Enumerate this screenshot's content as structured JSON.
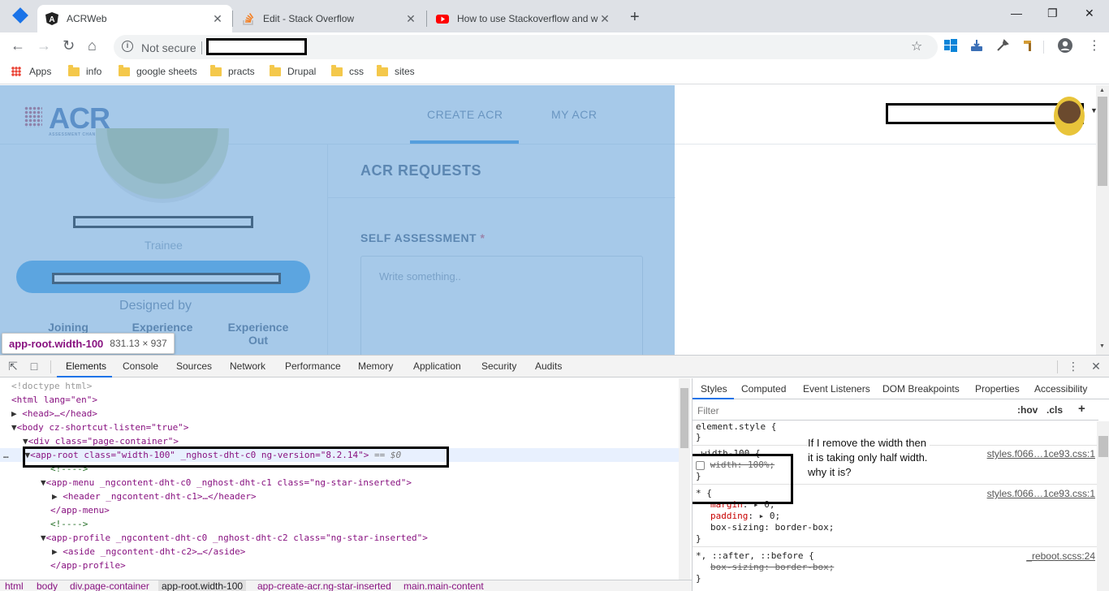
{
  "tabs": [
    {
      "title": "ACRWeb",
      "close": "✕"
    },
    {
      "title": "Edit - Stack Overflow",
      "close": "✕"
    },
    {
      "title": "How to use Stackoverflow and w",
      "close": "✕"
    }
  ],
  "new_tab": "+",
  "window_controls": {
    "minimize": "—",
    "maximize": "❐",
    "close": "✕"
  },
  "omnibox": {
    "security_label": "Not secure"
  },
  "bookmarks": [
    {
      "label": "Apps",
      "icon": "apps-grid-icon"
    },
    {
      "label": "info",
      "icon": "folder-icon"
    },
    {
      "label": "google sheets",
      "icon": "folder-icon"
    },
    {
      "label": "practs",
      "icon": "folder-icon"
    },
    {
      "label": "Drupal",
      "icon": "folder-icon"
    },
    {
      "label": "css",
      "icon": "folder-icon"
    },
    {
      "label": "sites",
      "icon": "folder-icon"
    }
  ],
  "app": {
    "logo": "ACR",
    "logo_tagline": "ASSESSMENT CHANGE REQUEST",
    "nav": {
      "create": "CREATE ACR",
      "mine": "MY ACR"
    },
    "profile": {
      "role": "Trainee",
      "designed_by": "Designed by",
      "stats": [
        "Joining",
        "Experience",
        "Experience Out"
      ]
    },
    "main": {
      "heading": "ACR REQUESTS",
      "field_label": "SELF ASSESSMENT",
      "required_mark": "*",
      "textarea_placeholder": "Write something.."
    },
    "overlay_color": "#6fa8dc"
  },
  "inspect_tooltip": {
    "name": "app-root.width-100",
    "size": "831.13 × 937"
  },
  "devtools": {
    "tabs": [
      "Elements",
      "Console",
      "Sources",
      "Network",
      "Performance",
      "Memory",
      "Application",
      "Security",
      "Audits"
    ],
    "dom_lines": {
      "doctype": "<!doctype html>",
      "html_open": "<html lang=\"en\">",
      "head": "<head>…</head>",
      "body": "<body cz-shortcut-listen=\"true\">",
      "div": "<div class=\"page-container\">",
      "app_root": "<app-root class=\"width-100\" _nghost-dht-c0 ng-version=\"8.2.14\">",
      "app_root_marker": "== $0",
      "comment1": "<!---->",
      "app_menu": "<app-menu _ngcontent-dht-c0 _nghost-dht-c1 class=\"ng-star-inserted\">",
      "header": "<header _ngcontent-dht-c1>…</header>",
      "app_menu_close": "</app-menu>",
      "comment2": "<!---->",
      "app_profile": "<app-profile _ngcontent-dht-c0 _nghost-dht-c2 class=\"ng-star-inserted\">",
      "aside": "<aside _ngcontent-dht-c2>…</aside>",
      "app_profile_close": "</app-profile>"
    },
    "breadcrumbs": [
      "html",
      "body",
      "div.page-container",
      "app-root.width-100",
      "app-create-acr.ng-star-inserted",
      "main.main-content"
    ],
    "styles_tabs": [
      "Styles",
      "Computed",
      "Event Listeners",
      "DOM Breakpoints",
      "Properties",
      "Accessibility"
    ],
    "filter_placeholder": "Filter",
    "filter_buttons": {
      "hov": ":hov",
      "cls": ".cls",
      "add": "+"
    },
    "rules": {
      "element_style": "element.style {",
      "close_brace": "}",
      "width_selector": ".width-100 {",
      "width_decl": "width: 100%;",
      "width_source": "styles.f066…1ce93.css:1",
      "star_selector": "* {",
      "margin_name": "margin",
      "margin_val": "0;",
      "padding_name": "padding",
      "padding_val": "0;",
      "boxsizing_decl": "box-sizing: border-box;",
      "star_source": "styles.f066…1ce93.css:1",
      "after_selector": "*, ::after, ::before {",
      "after_decl": "box-sizing: border-box;",
      "after_source": "_reboot.scss:24"
    },
    "annotation": "If I remove the width then it is taking only half width. why it is?"
  }
}
